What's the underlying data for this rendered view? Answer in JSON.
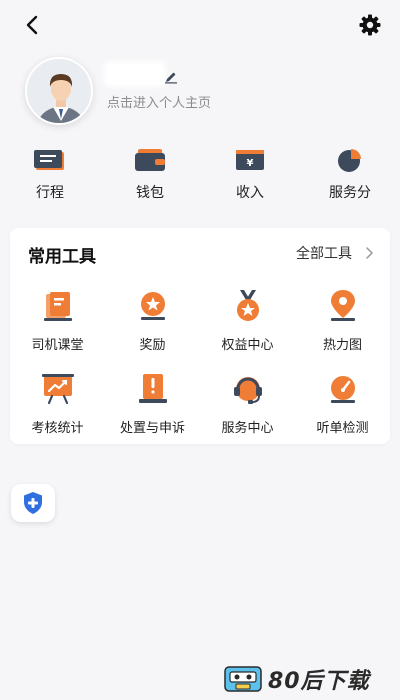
{
  "header": {
    "back_icon": "chevron-left-icon",
    "settings_icon": "gear-icon"
  },
  "profile": {
    "hint": "点击进入个人主页",
    "edit_icon": "pencil-icon"
  },
  "stats": [
    {
      "label": "行程",
      "icon": "itinerary-card-icon"
    },
    {
      "label": "钱包",
      "icon": "wallet-icon"
    },
    {
      "label": "收入",
      "icon": "income-yen-icon"
    },
    {
      "label": "服务分",
      "icon": "pie-chart-icon"
    }
  ],
  "tools": {
    "title": "常用工具",
    "all_label": "全部工具",
    "items": [
      {
        "label": "司机课堂",
        "icon": "book-icon"
      },
      {
        "label": "奖励",
        "icon": "star-badge-icon"
      },
      {
        "label": "权益中心",
        "icon": "medal-icon"
      },
      {
        "label": "热力图",
        "icon": "map-pin-icon"
      },
      {
        "label": "考核统计",
        "icon": "trend-board-icon"
      },
      {
        "label": "处置与申诉",
        "icon": "alert-document-icon"
      },
      {
        "label": "服务中心",
        "icon": "headset-icon"
      },
      {
        "label": "听单检测",
        "icon": "speedometer-icon"
      }
    ]
  },
  "floating": {
    "icon": "shield-plus-icon"
  },
  "watermark": {
    "text": "80后下载"
  },
  "colors": {
    "accent_orange": "#f07d35",
    "dark_slate": "#3d4a5c",
    "shield_blue": "#2f6fe0"
  }
}
